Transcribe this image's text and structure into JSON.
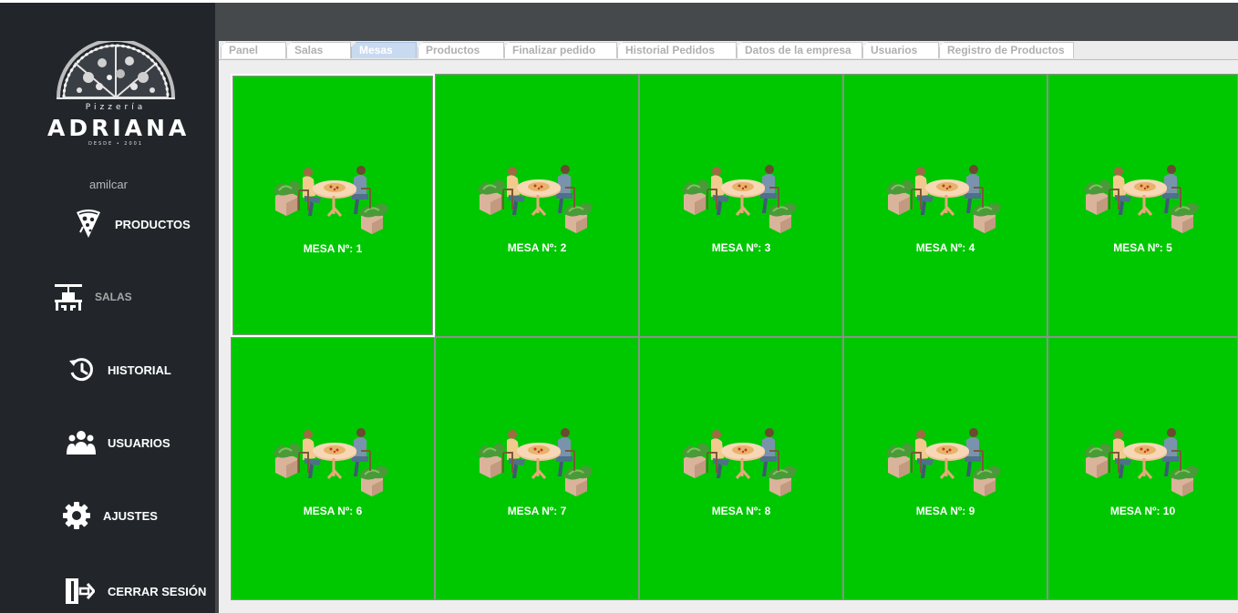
{
  "brand": {
    "subtitle": "Pizzería",
    "name": "ADRIANA",
    "since": "DESDE • 2001"
  },
  "user": {
    "name": "amilcar"
  },
  "nav": [
    {
      "label": "PRODUCTOS",
      "icon": "pizza-slice-icon"
    },
    {
      "label": "SALAS",
      "icon": "dining-table-icon"
    },
    {
      "label": "HISTORIAL",
      "icon": "history-icon"
    },
    {
      "label": "USUARIOS",
      "icon": "users-icon"
    },
    {
      "label": "AJUSTES",
      "icon": "gear-icon"
    },
    {
      "label": "CERRAR SESIÓN",
      "icon": "logout-icon"
    }
  ],
  "tabs": [
    {
      "label": "Panel"
    },
    {
      "label": "Salas"
    },
    {
      "label": "Mesas",
      "active": true
    },
    {
      "label": "Productos"
    },
    {
      "label": "Finalizar pedido"
    },
    {
      "label": "Historial Pedidos"
    },
    {
      "label": "Datos de la empresa"
    },
    {
      "label": "Usuarios"
    },
    {
      "label": "Registro de Productos"
    }
  ],
  "mesas": [
    {
      "label": "MESA Nº: 1"
    },
    {
      "label": "MESA Nº: 2"
    },
    {
      "label": "MESA Nº: 3"
    },
    {
      "label": "MESA Nº: 4"
    },
    {
      "label": "MESA Nº: 5"
    },
    {
      "label": "MESA Nº: 6"
    },
    {
      "label": "MESA Nº: 7"
    },
    {
      "label": "MESA Nº: 8"
    },
    {
      "label": "MESA Nº: 9"
    },
    {
      "label": "MESA Nº: 10"
    }
  ],
  "colors": {
    "sidebar": "#22262b",
    "topbar": "#45494c",
    "table_free": "#00c800",
    "tab_active": "#c8daf0"
  }
}
